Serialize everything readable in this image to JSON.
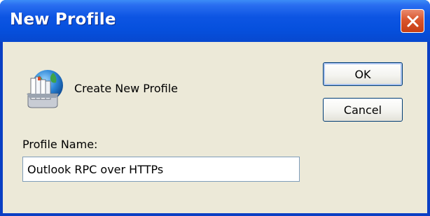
{
  "window": {
    "title": "New Profile",
    "close_icon": "close-icon"
  },
  "dialog": {
    "icon": "mail-profile-icon",
    "heading": "Create New Profile",
    "profile_name_label": "Profile Name:",
    "profile_name_value": "Outlook RPC over HTTPs"
  },
  "buttons": {
    "ok_label": "OK",
    "cancel_label": "Cancel"
  },
  "colors": {
    "titlebar": "#0650dd",
    "client": "#ece9d8",
    "close_button": "#d9552d"
  }
}
